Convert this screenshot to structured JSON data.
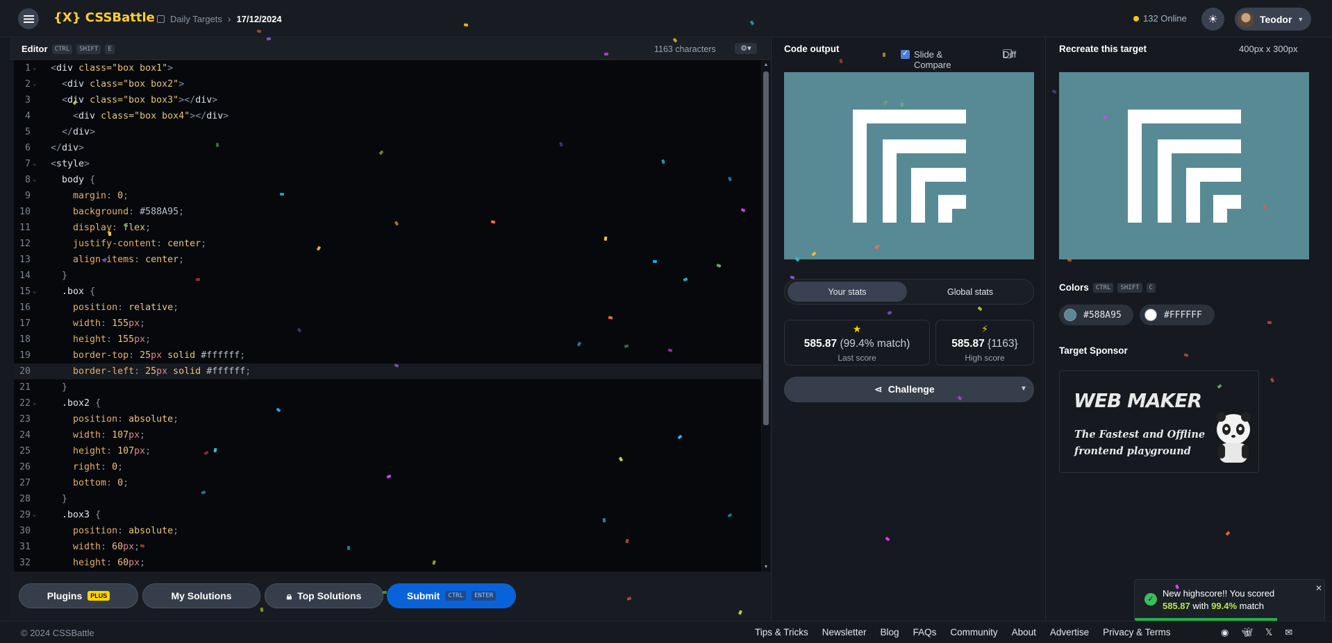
{
  "header": {
    "brand": "{X} CSSBattle",
    "breadcrumb_section": "Daily Targets",
    "breadcrumb_date": "17/12/2024",
    "online_text": "132 Online",
    "user_name": "Teodor"
  },
  "editor": {
    "title": "Editor",
    "shortcut": [
      "CTRL",
      "SHIFT",
      "E"
    ],
    "char_count": "1163 characters",
    "lines": [
      "<div class=\"box box1\">",
      "  <div class=\"box box2\">",
      "  <div class=\"box box3\"></div>",
      "    <div class=\"box box4\"></div>",
      "  </div>",
      "</div>",
      "<style>",
      "  body {",
      "    margin: 0;",
      "    background: #588A95;",
      "    display: flex;",
      "    justify-content: center;",
      "    align-items: center;",
      "  }",
      "  .box {",
      "    position: relative;",
      "    width: 155px;",
      "    height: 155px;",
      "    border-top: 25px solid #ffffff;",
      "    border-left: 25px solid #ffffff;",
      "  }",
      "  .box2 {",
      "    position: absolute;",
      "    width: 107px;",
      "    height: 107px;",
      "    right: 0;",
      "    bottom: 0;",
      "  }",
      "  .box3 {",
      "    position: absolute;",
      "    width: 60px;",
      "    height: 60px;"
    ],
    "active_line": 20,
    "fold_lines": [
      1,
      2,
      7,
      8,
      15,
      22,
      29
    ]
  },
  "bottom_bar": {
    "plugins": "Plugins",
    "plugins_badge": "PLUS",
    "my_solutions": "My Solutions",
    "top_solutions": "Top Solutions",
    "submit": "Submit",
    "submit_shortcut": [
      "CTRL",
      "ENTER"
    ]
  },
  "output": {
    "title": "Code output",
    "slide_compare": "Slide & Compare",
    "diff": "Diff"
  },
  "stats": {
    "tab_yours": "Your stats",
    "tab_global": "Global stats",
    "last_score": "585.87",
    "last_match": "(99.4% match)",
    "last_label": "Last score",
    "high_score": "585.87",
    "high_chars": "{1163}",
    "high_label": "High score",
    "challenge": "Challenge"
  },
  "target": {
    "title": "Recreate this target",
    "size": "400px x 300px",
    "colors_title": "Colors",
    "colors_shortcut": [
      "CTRL",
      "SHIFT",
      "C"
    ],
    "colors": [
      "#588A95",
      "#FFFFFF"
    ],
    "sponsor_title": "Target Sponsor",
    "sponsor_logo": "WEB MAKER",
    "sponsor_tagline": "The Fastest and Offline frontend playground"
  },
  "toast": {
    "line1": "New highscore!! You scored",
    "score": "585.87",
    "with": "with",
    "match": "99.4%",
    "suffix": "match"
  },
  "footer": {
    "copyright": "© 2024 CSSBattle",
    "links": [
      "Tips & Tricks",
      "Newsletter",
      "Blog",
      "FAQs",
      "Community",
      "About",
      "Advertise",
      "Privacy & Terms"
    ]
  },
  "colors": {
    "target_bg": "#588A95",
    "accent_yellow": "#ffcc33",
    "submit_blue": "#0a62d8"
  }
}
